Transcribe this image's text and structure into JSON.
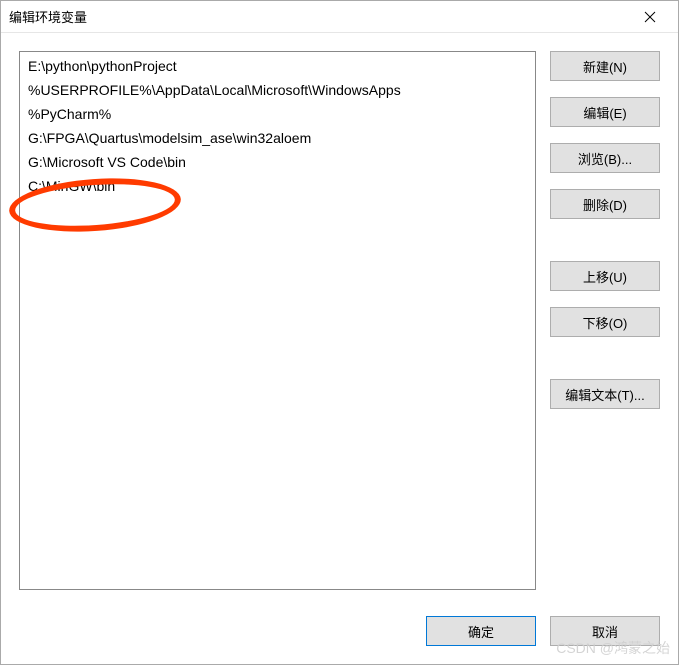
{
  "titlebar": {
    "title": "编辑环境变量"
  },
  "paths": [
    "E:\\python\\pythonProject",
    "%USERPROFILE%\\AppData\\Local\\Microsoft\\WindowsApps",
    "%PyCharm%",
    "G:\\FPGA\\Quartus\\modelsim_ase\\win32aloem",
    "G:\\Microsoft VS Code\\bin",
    "C:\\MinGW\\bin"
  ],
  "side": {
    "new_label": "新建(N)",
    "edit_label": "编辑(E)",
    "browse_label": "浏览(B)...",
    "delete_label": "删除(D)",
    "moveup_label": "上移(U)",
    "movedown_label": "下移(O)",
    "edittext_label": "编辑文本(T)..."
  },
  "bottom": {
    "ok_label": "确定",
    "cancel_label": "取消"
  },
  "watermark": "CSDN @鸿蒙之始"
}
